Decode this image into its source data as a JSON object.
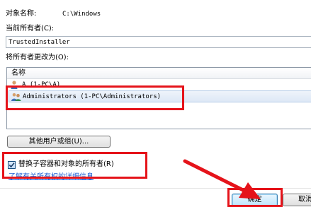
{
  "object_name": {
    "label": "对象名称:",
    "value": "C:\\Windows"
  },
  "current_owner": {
    "label": "当前所有者(C):",
    "value": "TrustedInstaller"
  },
  "change_owner": {
    "label": "将所有者更改为(O):",
    "column_header": "名称",
    "items": [
      {
        "label": "A (1-PC\\A)",
        "icon": "user-icon",
        "selected": false
      },
      {
        "label": "Administrators (1-PC\\Administrators)",
        "icon": "user-group-icon",
        "selected": true
      }
    ]
  },
  "other_users_button": "其他用户或组(U)...",
  "replace_owner_checkbox": {
    "label": "替换子容器和对象的所有者(R)",
    "checked": true
  },
  "help_link": "了解有关所有权的详细信息",
  "buttons": {
    "ok": "确定",
    "cancel": "取消"
  },
  "colors": {
    "highlight_box": "#e5131a",
    "arrow": "#e5131a",
    "link": "#1c5fd6"
  }
}
